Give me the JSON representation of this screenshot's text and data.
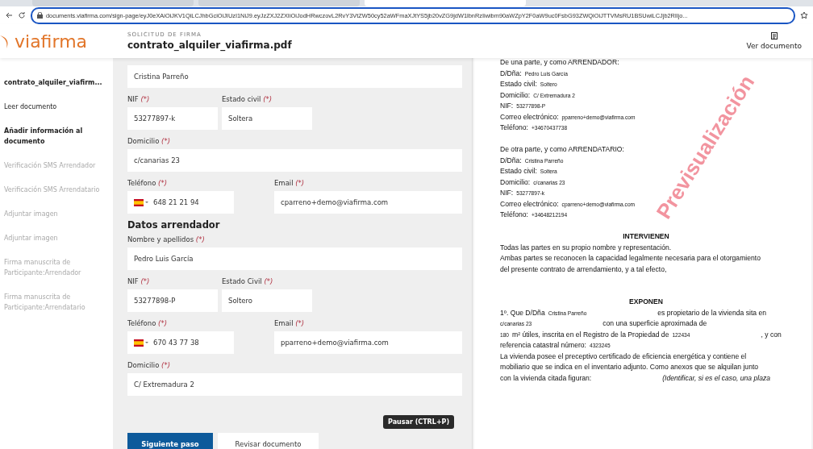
{
  "browser": {
    "tabs": [
      {
        "selected": false
      },
      {
        "selected": false
      },
      {
        "selected": true
      }
    ],
    "url": "documents.viafirma.com/sign-page/eyJ0eXAiOiJKV1QiLCJhbGciOiJIUzI1NiJ9.eyJzZXJ2ZXIiOiJodHRwczovL2RvY3VtZW50cy52aWFmaXJtYS5jb20vZG9jdW1lbnRzIiwibm90aWZpY2F0aW9uc0FsbG93ZWQiOiJTTVMsRU1BSUwiLCJjb2RlIjo..."
  },
  "header": {
    "logo": "viafirma",
    "subtitle": "SOLICITUD DE FIRMA",
    "title": "contrato_alquiler_viafirma.pdf",
    "view_button": "Ver documento"
  },
  "sidebar": {
    "items": [
      {
        "label": "contrato_alquiler_viafirm...",
        "kind": "title"
      },
      {
        "label": "Leer documento",
        "kind": "done"
      },
      {
        "label": "Añadir información al documento",
        "kind": "current"
      },
      {
        "label": "Verificación SMS Arrendador",
        "kind": "pending"
      },
      {
        "label": "Verificación SMS Arrendatario",
        "kind": "pending"
      },
      {
        "label": "Adjuntar imagen",
        "kind": "pending"
      },
      {
        "label": "Adjuntar imagen",
        "kind": "pending"
      },
      {
        "label": "Firma manuscrita de Participante:Arrendador",
        "kind": "pending"
      },
      {
        "label": "Firma manuscrita de Participante:Arrendatario",
        "kind": "pending"
      }
    ]
  },
  "form": {
    "rows": [
      {
        "kind": "fields",
        "fields": [
          {
            "kind": "full",
            "value": "Cristina Parreño"
          }
        ]
      },
      {
        "kind": "fields",
        "fields": [
          {
            "kind": "short",
            "label": "NIF",
            "mark": "(*)",
            "value": "53277897-k"
          },
          {
            "kind": "short",
            "label": "Estado civil",
            "mark": "(*)",
            "value": "Soltera"
          }
        ]
      },
      {
        "kind": "fields",
        "fields": [
          {
            "kind": "full",
            "label": "Domicilio",
            "mark": "(*)",
            "value": "c/canarias 23"
          }
        ]
      },
      {
        "kind": "fields",
        "fields": [
          {
            "kind": "phone",
            "label": "Teléfono",
            "mark": "(*)",
            "value": "648 21 21 94"
          },
          {
            "kind": "email",
            "label": "Email",
            "mark": "(*)",
            "value": "cparreno+demo@viafirma.com"
          }
        ]
      },
      {
        "kind": "heading",
        "text": "Datos arrendador"
      },
      {
        "kind": "fields",
        "fields": [
          {
            "kind": "full",
            "label": "Nombre y apellidos",
            "mark": "(*)",
            "value": "Pedro Luis García"
          }
        ]
      },
      {
        "kind": "fields",
        "fields": [
          {
            "kind": "short",
            "label": "NIF",
            "mark": "(*)",
            "value": "53277898-P"
          },
          {
            "kind": "short",
            "label": "Estado Civil",
            "mark": "(*)",
            "value": "Soltero"
          }
        ]
      },
      {
        "kind": "fields",
        "fields": [
          {
            "kind": "phone",
            "label": "Teléfono",
            "mark": "(*)",
            "value": "670 43 77 38"
          },
          {
            "kind": "email",
            "label": "Email",
            "mark": "(*)",
            "value": "pparreno+demo@viafirma.com"
          }
        ]
      },
      {
        "kind": "fields",
        "fields": [
          {
            "kind": "full",
            "label": "Domicilio",
            "mark": "(*)",
            "value": "C/ Extremadura 2"
          }
        ]
      }
    ],
    "buttons": [
      {
        "label": "Siguiente paso",
        "kind": "primary"
      },
      {
        "label": "Revisar documento",
        "kind": "secondary"
      }
    ],
    "tooltip": "Pausar (CTRL+P)"
  },
  "document": {
    "watermark": "Previsualización",
    "lines": [
      {
        "kind": "text",
        "segments": [
          {
            "kind": "text",
            "t": "De una parte, y como ARRENDADOR:"
          }
        ]
      },
      {
        "kind": "text",
        "segments": [
          {
            "kind": "text",
            "t": "D/Dña:"
          },
          {
            "kind": "value",
            "t": "Pedro Luis García"
          }
        ]
      },
      {
        "kind": "text",
        "segments": [
          {
            "kind": "text",
            "t": "Estado civil:"
          },
          {
            "kind": "value",
            "t": "Soltero"
          }
        ]
      },
      {
        "kind": "text",
        "segments": [
          {
            "kind": "text",
            "t": "Domicilio:"
          },
          {
            "kind": "value",
            "t": "C/ Extremadura 2"
          }
        ]
      },
      {
        "kind": "text",
        "segments": [
          {
            "kind": "text",
            "t": "NIF:"
          },
          {
            "kind": "value",
            "t": "53277898-P"
          }
        ]
      },
      {
        "kind": "text",
        "segments": [
          {
            "kind": "text",
            "t": "Correo electrónico:"
          },
          {
            "kind": "value",
            "t": "pparreno+demo@viafirma.com"
          }
        ]
      },
      {
        "kind": "text",
        "segments": [
          {
            "kind": "text",
            "t": "Teléfono:"
          },
          {
            "kind": "value",
            "t": "+34670437738"
          }
        ]
      },
      {
        "kind": "blank"
      },
      {
        "kind": "text",
        "segments": [
          {
            "kind": "text",
            "t": "De otra parte, y como ARRENDATARIO:"
          }
        ]
      },
      {
        "kind": "text",
        "segments": [
          {
            "kind": "text",
            "t": "D/Dña:"
          },
          {
            "kind": "value",
            "t": "Cristina Parreño"
          }
        ]
      },
      {
        "kind": "text",
        "segments": [
          {
            "kind": "text",
            "t": "Estado civil:"
          },
          {
            "kind": "value",
            "t": "Soltera"
          }
        ]
      },
      {
        "kind": "text",
        "segments": [
          {
            "kind": "text",
            "t": "Domicilio:"
          },
          {
            "kind": "value",
            "t": "c/canarias 23"
          }
        ]
      },
      {
        "kind": "text",
        "segments": [
          {
            "kind": "text",
            "t": "NIF:"
          },
          {
            "kind": "value",
            "t": "53277897-k"
          }
        ]
      },
      {
        "kind": "text",
        "segments": [
          {
            "kind": "text",
            "t": "Correo electrónico:"
          },
          {
            "kind": "value",
            "t": "cparreno+demo@viafirma.com"
          }
        ]
      },
      {
        "kind": "text",
        "segments": [
          {
            "kind": "text",
            "t": "Teléfono:"
          },
          {
            "kind": "value",
            "t": "+34648212194"
          }
        ]
      },
      {
        "kind": "blank"
      },
      {
        "kind": "heading",
        "segments": [
          {
            "kind": "text",
            "t": "INTERVIENEN"
          }
        ]
      },
      {
        "kind": "text",
        "segments": [
          {
            "kind": "text",
            "t": "Todas las partes en su propio nombre y representación."
          }
        ]
      },
      {
        "kind": "text",
        "segments": [
          {
            "kind": "text",
            "t": "Ambas partes se reconocen la capacidad legalmente necesaria para el otorgamiento"
          }
        ]
      },
      {
        "kind": "text",
        "segments": [
          {
            "kind": "text",
            "t": "del presente contrato de arrendamiento, y a tal efecto,"
          }
        ]
      },
      {
        "kind": "blank"
      },
      {
        "kind": "blank"
      },
      {
        "kind": "heading",
        "segments": [
          {
            "kind": "text",
            "t": "EXPONEN"
          }
        ]
      },
      {
        "kind": "text",
        "segments": [
          {
            "kind": "text",
            "t": "1º. Que  D/Dña"
          },
          {
            "kind": "value",
            "t": "Cristina Parreño"
          },
          {
            "kind": "gap"
          },
          {
            "kind": "text",
            "t": "es propietario de la vivienda sita en"
          }
        ]
      },
      {
        "kind": "text",
        "segments": [
          {
            "kind": "value",
            "t": "c/canarias 23"
          },
          {
            "kind": "gap"
          },
          {
            "kind": "text",
            "t": "con una superficie aproximada de"
          }
        ]
      },
      {
        "kind": "text",
        "segments": [
          {
            "kind": "value",
            "t": "180"
          },
          {
            "kind": "text",
            "t": "m² útiles, inscrita en el Registro de la Propiedad de"
          },
          {
            "kind": "value",
            "t": "122434"
          },
          {
            "kind": "gap"
          },
          {
            "kind": "text",
            "t": ", y con"
          }
        ]
      },
      {
        "kind": "text",
        "segments": [
          {
            "kind": "text",
            "t": "referencia catastral número:"
          },
          {
            "kind": "value",
            "t": "4323245"
          }
        ]
      },
      {
        "kind": "text",
        "segments": [
          {
            "kind": "text",
            "t": "La vivienda posee el preceptivo certificado de eficiencia energética y contiene el"
          }
        ]
      },
      {
        "kind": "text",
        "segments": [
          {
            "kind": "text",
            "t": "mobiliario que se indica en el inventario adjunto. Como anexos que se alquilan junto"
          }
        ]
      },
      {
        "kind": "text",
        "segments": [
          {
            "kind": "text",
            "t": "con la vivienda citada figuran:"
          },
          {
            "kind": "gap"
          },
          {
            "kind": "italic",
            "t": "(Identificar, si es el caso, una plaza"
          }
        ]
      }
    ]
  }
}
